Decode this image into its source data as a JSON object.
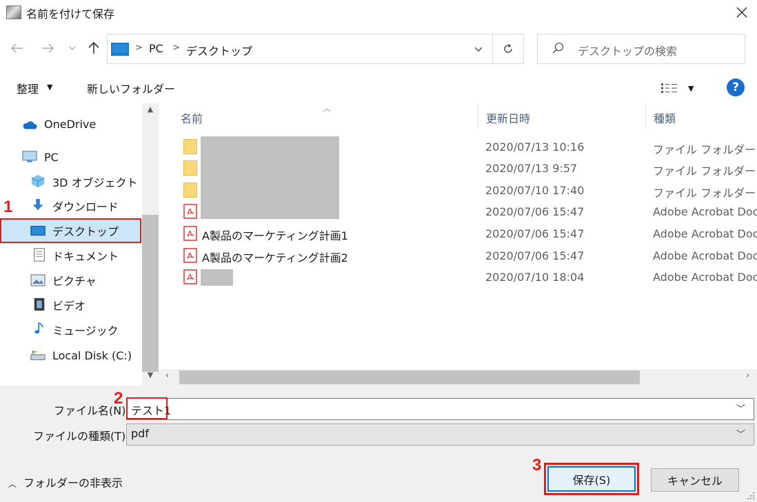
{
  "window": {
    "title": "名前を付けて保存"
  },
  "address": {
    "crumbs": [
      "PC",
      "デスクトップ"
    ]
  },
  "search": {
    "placeholder": "デスクトップの検索"
  },
  "toolbar": {
    "organize": "整理",
    "new_folder": "新しいフォルダー"
  },
  "nav": {
    "items": [
      {
        "label": "OneDrive",
        "icon": "onedrive-icon"
      },
      {
        "label": "PC",
        "icon": "pc-icon"
      },
      {
        "label": "3D オブジェクト",
        "icon": "3d-objects-icon"
      },
      {
        "label": "ダウンロード",
        "icon": "download-icon"
      },
      {
        "label": "デスクトップ",
        "icon": "desktop-icon"
      },
      {
        "label": "ドキュメント",
        "icon": "documents-icon"
      },
      {
        "label": "ピクチャ",
        "icon": "pictures-icon"
      },
      {
        "label": "ビデオ",
        "icon": "video-icon"
      },
      {
        "label": "ミュージック",
        "icon": "music-icon"
      },
      {
        "label": "Local Disk (C:)",
        "icon": "disk-icon"
      }
    ]
  },
  "list": {
    "headers": {
      "name": "名前",
      "date": "更新日時",
      "type": "種類"
    },
    "rows": [
      {
        "kind": "folder",
        "name": "",
        "date": "2020/07/13 10:16",
        "type": "ファイル フォルダー"
      },
      {
        "kind": "folder",
        "name": "",
        "date": "2020/07/13 9:57",
        "type": "ファイル フォルダー"
      },
      {
        "kind": "folder",
        "name": "",
        "date": "2020/07/10 17:40",
        "type": "ファイル フォルダー"
      },
      {
        "kind": "pdf",
        "name": "",
        "date": "2020/07/06 15:47",
        "type": "Adobe Acrobat Doc"
      },
      {
        "kind": "pdf",
        "name": "A製品のマーケティング計画1",
        "date": "2020/07/06 15:47",
        "type": "Adobe Acrobat Doc"
      },
      {
        "kind": "pdf",
        "name": "A製品のマーケティング計画2",
        "date": "2020/07/06 15:47",
        "type": "Adobe Acrobat Doc"
      },
      {
        "kind": "pdf",
        "name": "",
        "date": "2020/07/10 18:04",
        "type": "Adobe Acrobat Doc"
      }
    ]
  },
  "form": {
    "filename_label": "ファイル名(N):",
    "filename_value": "テスト1",
    "filetype_label": "ファイルの種類(T):",
    "filetype_value": "pdf"
  },
  "footer": {
    "hide_folders": "フォルダーの非表示",
    "save": "保存(S)",
    "cancel": "キャンセル"
  },
  "annotations": {
    "m1": "1",
    "m2": "2",
    "m3": "3"
  },
  "colors": {
    "accent": "#0078d7",
    "highlight": "#e01e1e",
    "selected": "#cde6f7"
  }
}
